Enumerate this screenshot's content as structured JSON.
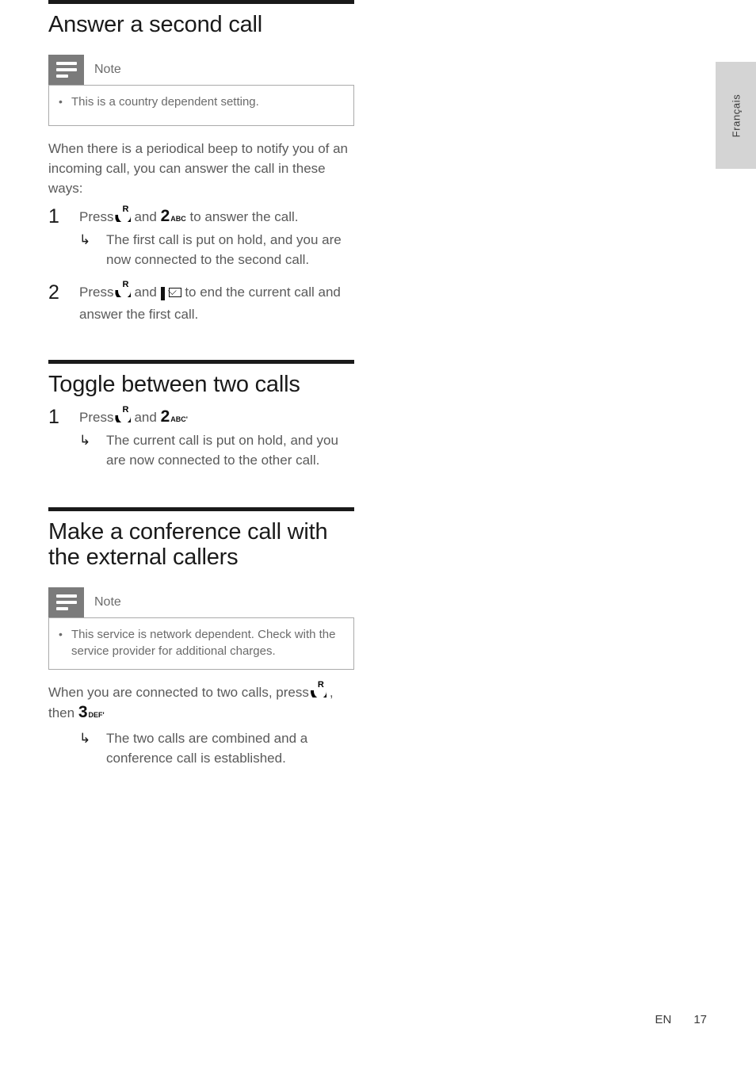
{
  "language_tab": {
    "label": "Français"
  },
  "sections": [
    {
      "id": "answer-second-call",
      "heading": "Answer a second call",
      "note": {
        "title": "Note",
        "icon": "note-lines-icon",
        "items": [
          "This is a country dependent setting."
        ]
      },
      "paragraph": "When there is a periodical beep to notify you of an incoming call, you can answer the call in these ways:",
      "steps": [
        {
          "number": "1",
          "text_before": "Press",
          "key_1": "call-key-R",
          "conjunction": "and",
          "key_2_digit": "2",
          "key_2_sub": "ABC",
          "text_after": "to answer the call.",
          "substeps": [
            {
              "arrow": "↳",
              "text": "The first call is put on hold, and you are now connected to the second call."
            }
          ]
        },
        {
          "number": "2",
          "text_before": "Press",
          "key_1": "call-key-R",
          "conjunction": "and",
          "key_2_digit": "",
          "key_2_sub": "",
          "key_end": "end-call-envelope-key",
          "text_after": "to end the current call and answer the first call.",
          "substeps": []
        }
      ]
    },
    {
      "id": "toggle-two-calls",
      "heading": "Toggle between two calls",
      "note": null,
      "paragraph": "",
      "steps": [
        {
          "number": "1",
          "text_before": "Press",
          "key_1": "call-key-R",
          "conjunction": "and",
          "key_2_digit": "2",
          "key_2_sub": "ABC'",
          "text_after": "",
          "substeps": [
            {
              "arrow": "↳",
              "text": "The current call is put on hold, and you are now connected to the other call."
            }
          ]
        }
      ]
    },
    {
      "id": "conference-call",
      "heading": "Make a conference call with the external callers",
      "note": {
        "title": "Note",
        "icon": "note-lines-icon",
        "items": [
          "This service is network dependent. Check with the service provider for additional charges."
        ]
      },
      "paragraph_parts": {
        "lead": "When you are connected to two calls, press",
        "key_1": "call-key-R",
        "mid": ", then",
        "key_2_digit": "3",
        "key_2_sub": "DEF'"
      },
      "substeps": [
        {
          "arrow": "↳",
          "text": "The two calls are combined and a conference call is established."
        }
      ]
    }
  ],
  "footer": {
    "language_code": "EN",
    "page_number": "17"
  },
  "colors": {
    "rule": "#1a1a1a",
    "heading": "#1a1a1a",
    "body_text": "#5a5a5a",
    "note_icon_bg": "#7b7b7b",
    "note_border": "#aaaaaa",
    "lang_tab_bg": "#d4d4d4"
  }
}
